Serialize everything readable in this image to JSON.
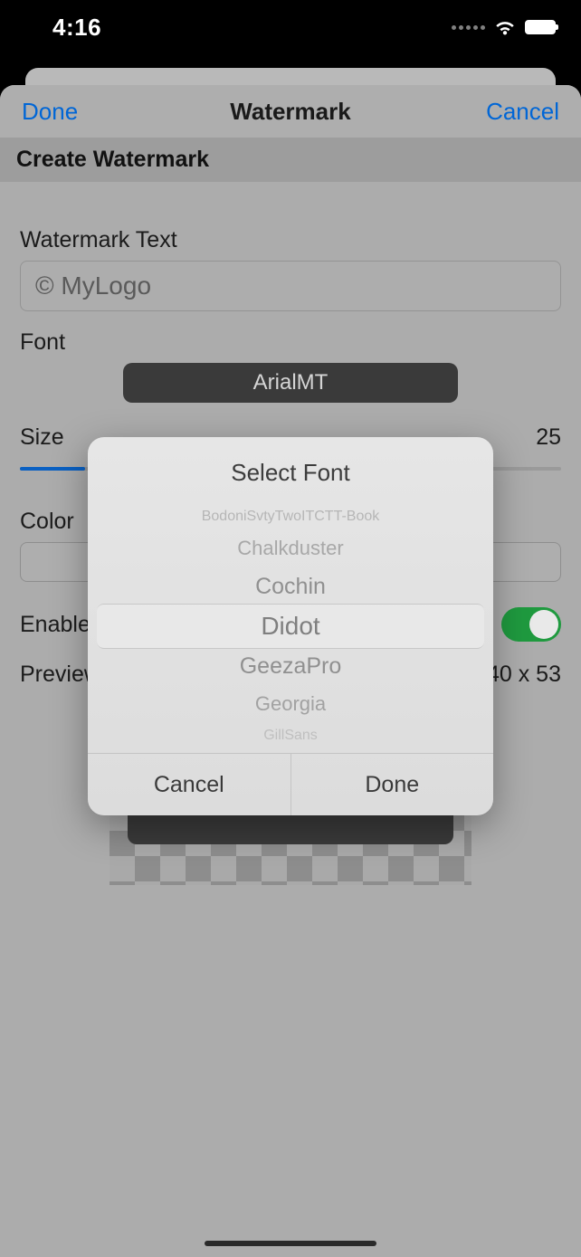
{
  "status": {
    "time": "4:16"
  },
  "nav": {
    "done": "Done",
    "title": "Watermark",
    "cancel": "Cancel"
  },
  "subheader": "Create Watermark",
  "watermark": {
    "text_label": "Watermark Text",
    "text_value": "© MyLogo",
    "font_label": "Font",
    "font_value": "ArialMT",
    "size_label": "Size",
    "size_value": "25",
    "color_label": "Color",
    "enable_label": "Enable",
    "enable_on": true,
    "preview_label": "Preview",
    "preview_dimensions": "40 x 53"
  },
  "font_picker": {
    "title": "Select Font",
    "options": [
      "BodoniSvtyTwoITCTT-Book",
      "Chalkduster",
      "Cochin",
      "Didot",
      "GeezaPro",
      "Georgia",
      "GillSans"
    ],
    "selected_index": 3,
    "cancel": "Cancel",
    "done": "Done"
  }
}
